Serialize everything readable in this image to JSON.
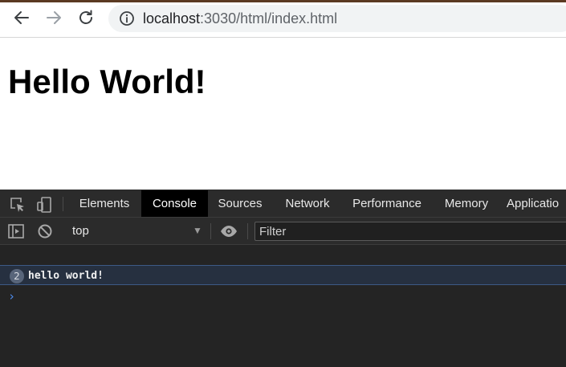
{
  "browser": {
    "url_host": "localhost",
    "url_rest": ":3030/html/index.html"
  },
  "page": {
    "heading": "Hello World!"
  },
  "devtools": {
    "tabs": [
      {
        "label": "Elements"
      },
      {
        "label": "Console",
        "active": true
      },
      {
        "label": "Sources"
      },
      {
        "label": "Network"
      },
      {
        "label": "Performance"
      },
      {
        "label": "Memory"
      },
      {
        "label": "Applicatio"
      }
    ],
    "context": "top",
    "filter_placeholder": "Filter",
    "messages": [
      {
        "count": "2",
        "text": "hello world!"
      }
    ],
    "prompt_symbol": "›"
  },
  "colors": {
    "devtools_bg": "#242424",
    "active_tab": "#000000",
    "prompt": "#4d8df0"
  }
}
